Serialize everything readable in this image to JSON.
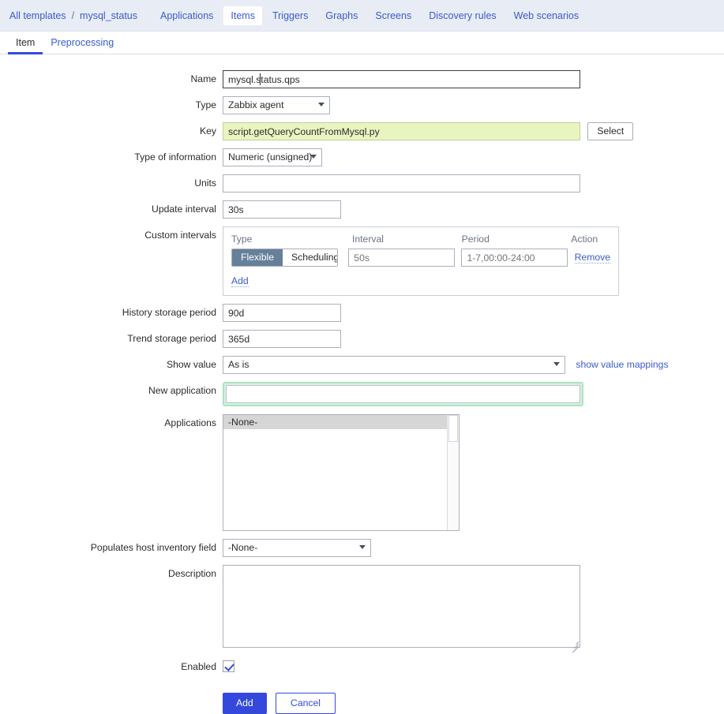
{
  "topnav": {
    "breadcrumb": {
      "root": "All templates",
      "separator": "/",
      "current": "mysql_status"
    },
    "items": [
      {
        "label": "Applications",
        "active": false
      },
      {
        "label": "Items",
        "active": true
      },
      {
        "label": "Triggers",
        "active": false
      },
      {
        "label": "Graphs",
        "active": false
      },
      {
        "label": "Screens",
        "active": false
      },
      {
        "label": "Discovery rules",
        "active": false
      },
      {
        "label": "Web scenarios",
        "active": false
      }
    ]
  },
  "tabs": [
    {
      "label": "Item",
      "active": true
    },
    {
      "label": "Preprocessing",
      "active": false
    }
  ],
  "form": {
    "name": {
      "label": "Name",
      "value": "mysql.status.qps"
    },
    "type": {
      "label": "Type",
      "value": "Zabbix agent"
    },
    "key": {
      "label": "Key",
      "value": "script.getQueryCountFromMysql.py",
      "select_button": "Select"
    },
    "type_of_information": {
      "label": "Type of information",
      "value": "Numeric (unsigned)"
    },
    "units": {
      "label": "Units",
      "value": ""
    },
    "update_interval": {
      "label": "Update interval",
      "value": "30s"
    },
    "custom_intervals": {
      "label": "Custom intervals",
      "headers": {
        "type": "Type",
        "interval": "Interval",
        "period": "Period",
        "action": "Action"
      },
      "rows": [
        {
          "type_flexible": "Flexible",
          "type_scheduling": "Scheduling",
          "selected_type": "Flexible",
          "interval_placeholder": "50s",
          "interval_value": "",
          "period_placeholder": "1-7,00:00-24:00",
          "period_value": "",
          "action": "Remove"
        }
      ],
      "add_link": "Add"
    },
    "history_storage_period": {
      "label": "History storage period",
      "value": "90d"
    },
    "trend_storage_period": {
      "label": "Trend storage period",
      "value": "365d"
    },
    "show_value": {
      "label": "Show value",
      "value": "As is",
      "mapping_link": "show value mappings"
    },
    "new_application": {
      "label": "New application",
      "value": "",
      "focused": true
    },
    "applications": {
      "label": "Applications",
      "options": [
        "-None-"
      ],
      "selected": "-None-"
    },
    "host_inventory_field": {
      "label": "Populates host inventory field",
      "value": "-None-"
    },
    "description": {
      "label": "Description",
      "value": ""
    },
    "enabled": {
      "label": "Enabled",
      "checked": true
    }
  },
  "footer": {
    "add": "Add",
    "cancel": "Cancel"
  },
  "colors": {
    "nav_bg": "#e8ecf5",
    "link": "#3a5ccc",
    "primary": "#3449db",
    "key_field_bg": "#e9f5c0",
    "toggle_on_bg": "#66809a",
    "focus_green": "#a8e5be"
  }
}
